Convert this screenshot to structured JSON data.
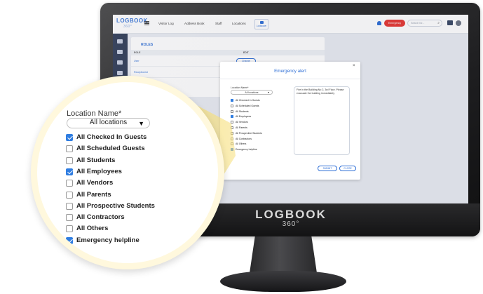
{
  "app": {
    "logo": "LOGBOOK",
    "logo_sub": "360°"
  },
  "topbar": {
    "nav": [
      "Visitor Log",
      "Address Book",
      "Staff",
      "Locations"
    ],
    "active_tab": "Lockdown",
    "emergency_label": "Emergency",
    "search_placeholder": "Search for..."
  },
  "roles_panel": {
    "title": "ROLES",
    "columns": [
      "ROLE",
      "EDIT"
    ],
    "rows": [
      {
        "role": "User",
        "action": "Change"
      },
      {
        "role": "Receptionist",
        "action": ""
      }
    ]
  },
  "modal": {
    "title": "Emergency alert",
    "close_icon": "×",
    "location_label": "Location Name*",
    "location_value": "All locations",
    "options": [
      {
        "label": "All Checked In Guests",
        "checked": true
      },
      {
        "label": "All Scheduled Guests",
        "checked": false
      },
      {
        "label": "All Students",
        "checked": false
      },
      {
        "label": "All Employees",
        "checked": true
      },
      {
        "label": "All Vendors",
        "checked": false
      },
      {
        "label": "All Parents",
        "checked": false
      },
      {
        "label": "All Prospective Students",
        "checked": false
      },
      {
        "label": "All Contractors",
        "checked": false
      },
      {
        "label": "All Others",
        "checked": false
      },
      {
        "label": "Emergency helpline",
        "checked": true
      }
    ],
    "message": "Fire in the Building No 2, 3rd Floor. Please evacuate the building immediately",
    "submit_label": "SUBMIT",
    "close_label": "CLOSE"
  },
  "zoom": {
    "location_label": "Location Name*",
    "location_value": "All locations"
  },
  "monitor": {
    "brand": "LOGBOOK",
    "brand_sub": "360°"
  },
  "colors": {
    "accent": "#2f6fd6",
    "checkbox": "#2f7de1",
    "emergency": "#e53935",
    "sidebar": "#25324f",
    "magnifier": "#f6df7a"
  }
}
